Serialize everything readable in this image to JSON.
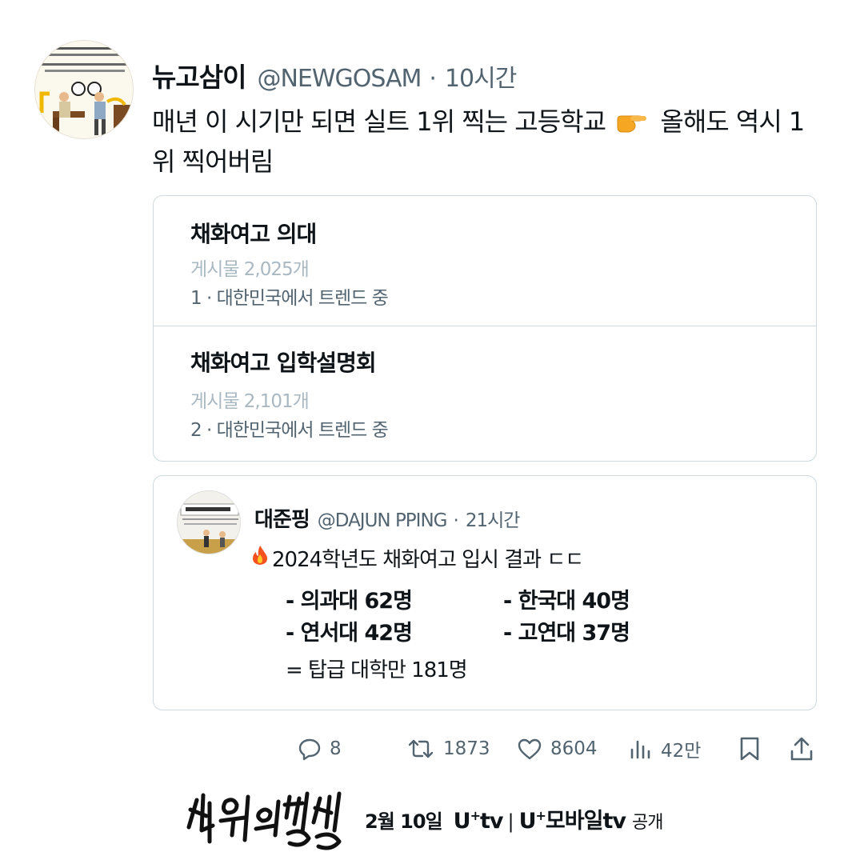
{
  "tweet": {
    "display_name": "뉴고삼이",
    "handle": "@NEWGOSAM",
    "separator": "·",
    "time": "10시간",
    "text_before": "매년 이 시기만 되면 실트 1위 찍는 고등학교",
    "pointer_icon": "backhand-index-pointing-right",
    "text_after": "올해도 역시 1위 찍어버림"
  },
  "trends": [
    {
      "title": "채화여고 의대",
      "count": "게시물 2,025개",
      "meta": "1 · 대한민국에서 트렌드 중"
    },
    {
      "title": "채화여고 입학설명회",
      "count": "게시물 2,101개",
      "meta": "2 · 대한민국에서 트렌드 중"
    }
  ],
  "quote": {
    "display_name": "대준핑",
    "handle": "@DAJUN PPING",
    "separator": "·",
    "time": "21시간",
    "fire_icon": "fire",
    "headline": "2024학년도 채화여고 입시 결과 ㄷㄷ",
    "results": [
      "-  의과대 62명",
      "-  연서대 42명",
      "-  한국대 40명",
      "-  고연대 37명"
    ],
    "total": "= 탑급 대학만 181명"
  },
  "actions": {
    "replies": "8",
    "retweets": "1873",
    "likes": "8604",
    "views": "42만",
    "icons": [
      "reply-icon",
      "retweet-icon",
      "like-icon",
      "views-icon",
      "bookmark-icon",
      "share-icon"
    ]
  },
  "promo": {
    "logo_text": "선의의경쟁",
    "date": "2월 10일",
    "brand1": "U",
    "brand1_suffix": "tv",
    "divider": "|",
    "brand2": "U",
    "brand2_suffix": "모바일tv",
    "tail": "공개"
  },
  "colors": {
    "text": "#0f1419",
    "secondary": "#536471",
    "border": "#cfd9de",
    "muted": "#aab8c2"
  }
}
